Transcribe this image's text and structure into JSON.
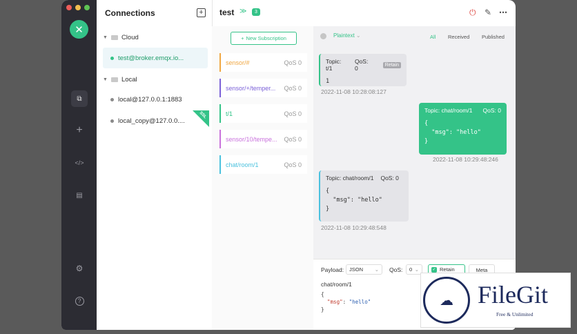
{
  "sidebar": {
    "logo": "✕",
    "icons": [
      {
        "name": "connections-icon",
        "glyph": "⧉",
        "active": true
      },
      {
        "name": "plus-icon",
        "glyph": "+",
        "active": false
      },
      {
        "name": "script-icon",
        "glyph": "</>",
        "active": false
      },
      {
        "name": "log-icon",
        "glyph": "▤",
        "active": false
      },
      {
        "name": "settings-icon",
        "glyph": "⚙",
        "active": false
      },
      {
        "name": "help-icon",
        "glyph": "?",
        "active": false
      }
    ]
  },
  "connections": {
    "title": "Connections",
    "add_glyph": "+",
    "groups": [
      {
        "name": "Cloud",
        "items": [
          {
            "label": "test@broker.emqx.io...",
            "active": true
          }
        ]
      },
      {
        "name": "Local",
        "items": [
          {
            "label": "local@127.0.0.1:1883",
            "active": false
          },
          {
            "label": "local_copy@127.0.0....",
            "active": false,
            "ssl": true
          }
        ]
      }
    ],
    "ssl_label": "SSL"
  },
  "topbar": {
    "name": "test",
    "chevron": "≫",
    "count": "3",
    "power_glyph": "⏻",
    "edit_glyph": "✎",
    "more_glyph": "⋯"
  },
  "subscriptions": {
    "new_label": "New Subscription",
    "items": [
      {
        "topic": "sensor/#",
        "qos": "QoS 0",
        "color": "#f0a742"
      },
      {
        "topic": "sensor/+/temper...",
        "qos": "QoS 0",
        "color": "#7b61d8"
      },
      {
        "topic": "t/1",
        "qos": "QoS 0",
        "color": "#34c388"
      },
      {
        "topic": "sensor/10/tempe...",
        "qos": "QoS 0",
        "color": "#c972dc"
      },
      {
        "topic": "chat/room/1",
        "qos": "QoS 0",
        "color": "#4ac1de"
      }
    ]
  },
  "messages": {
    "payload_type": "Plaintext",
    "filters": {
      "all": "All",
      "received": "Received",
      "published": "Published"
    },
    "list": [
      {
        "topic": "Topic: t/1",
        "qos": "QoS: 0",
        "retain": "Retain",
        "body": "1",
        "time": "2022-11-08 10:28:08:127"
      },
      {
        "topic": "Topic: chat/room/1",
        "qos": "QoS: 0",
        "body": "{\n  \"msg\": \"hello\"\n}",
        "time": "2022-11-08 10:29:48:246"
      },
      {
        "topic": "Topic: chat/room/1",
        "qos": "QoS: 0",
        "body": "{\n  \"msg\": \"hello\"\n}",
        "time": "2022-11-08 10:29:48:548"
      }
    ]
  },
  "editor": {
    "payload_label": "Payload:",
    "payload_format": "JSON",
    "qos_label": "QoS:",
    "qos_value": "0",
    "retain_label": "Retain",
    "meta_label": "Meta",
    "topic": "chat/room/1",
    "code_open": "{",
    "code_key": "\"msg\"",
    "code_sep": ": ",
    "code_val": "\"hello\"",
    "code_close": "}"
  },
  "watermark": {
    "name": "FileGit",
    "tagline": "Free & Unlimited"
  }
}
